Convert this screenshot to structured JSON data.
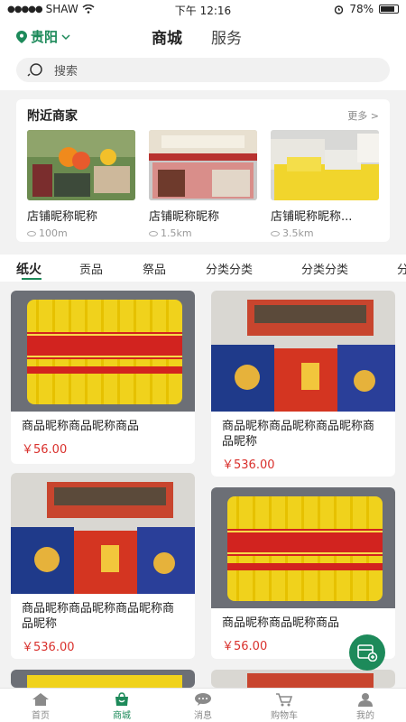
{
  "status_bar": {
    "carrier": "SHAW",
    "time": "下午 12:16",
    "battery": "78%"
  },
  "header": {
    "location": "贵阳",
    "tabs": [
      {
        "label": "商城",
        "active": true
      },
      {
        "label": "服务",
        "active": false
      }
    ],
    "search_placeholder": "搜索"
  },
  "nearby": {
    "title": "附近商家",
    "more": "更多 >",
    "shops": [
      {
        "name": "店铺昵称昵称",
        "distance": "100m"
      },
      {
        "name": "店铺昵称昵称",
        "distance": "1.5km"
      },
      {
        "name": "店铺昵称昵称...",
        "distance": "3.5km"
      }
    ]
  },
  "categories": [
    "纸火",
    "贡品",
    "祭品",
    "分类分类",
    "分类分类",
    "分"
  ],
  "products": [
    {
      "name": "商品昵称商品昵称商品",
      "price": "￥56.00",
      "image": "yellow-paper-bundle"
    },
    {
      "name": "商品昵称商品昵称商品昵称商品昵称",
      "price": "￥536.00",
      "image": "ritual-paper-set"
    },
    {
      "name": "商品昵称商品昵称商品昵称商品昵称",
      "price": "￥536.00",
      "image": "ritual-paper-set"
    },
    {
      "name": "商品昵称商品昵称商品",
      "price": "￥56.00",
      "image": "yellow-paper-bundle"
    }
  ],
  "fab": {
    "icon": "shop-cart-icon"
  },
  "tabbar": [
    {
      "label": "首页",
      "icon": "home-icon",
      "active": false
    },
    {
      "label": "商城",
      "icon": "shopping-bag-icon",
      "active": true
    },
    {
      "label": "消息",
      "icon": "message-icon",
      "active": false
    },
    {
      "label": "购物车",
      "icon": "cart-icon",
      "active": false
    },
    {
      "label": "我的",
      "icon": "user-icon",
      "active": false
    }
  ],
  "colors": {
    "accent": "#1d8a5a",
    "price": "#d9302c",
    "background": "#f2f2f2"
  }
}
